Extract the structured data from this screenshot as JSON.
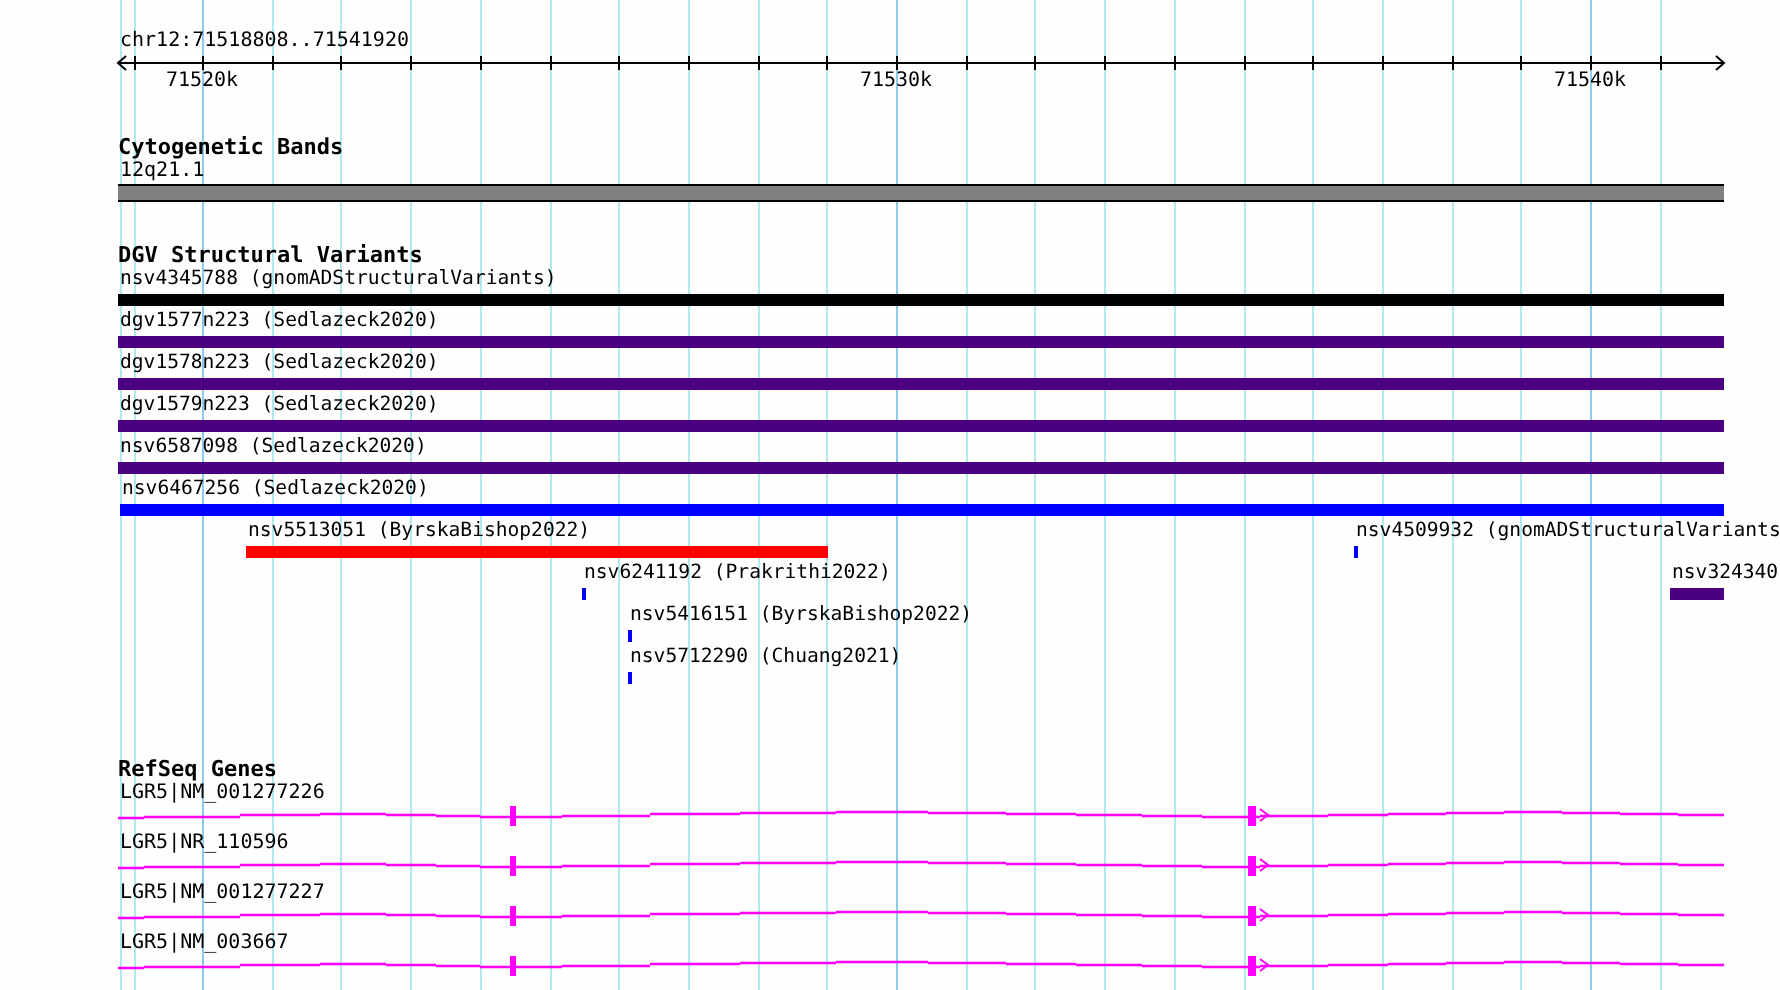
{
  "location": "chr12:71518808..71541920",
  "ruler": {
    "ticks": [
      "71520k",
      "71530k",
      "71540k"
    ]
  },
  "tracks": [
    {
      "title": "Cytogenetic Bands",
      "kind": "bands",
      "features": [
        {
          "label": "12q21.1",
          "color": "#808080"
        }
      ]
    },
    {
      "title": "DGV Structural Variants",
      "kind": "variants",
      "features": [
        {
          "label": "nsv4345788 (gnomADStructuralVariants)",
          "color": "#000000"
        },
        {
          "label": "dgv1577n223 (Sedlazeck2020)",
          "color": "#4b0082"
        },
        {
          "label": "dgv1578n223 (Sedlazeck2020)",
          "color": "#4b0082"
        },
        {
          "label": "dgv1579n223 (Sedlazeck2020)",
          "color": "#4b0082"
        },
        {
          "label": "nsv6587098 (Sedlazeck2020)",
          "color": "#4b0082"
        },
        {
          "label": "nsv6467256 (Sedlazeck2020)",
          "color": "#0000ff"
        },
        {
          "label": "nsv5513051 (ByrskaBishop2022)",
          "color": "#ff0000"
        },
        {
          "label": "nsv4509932 (gnomADStructuralVariants",
          "color": "#0000ff"
        },
        {
          "label": "nsv6241192 (Prakrithi2022)",
          "color": "#0000ff"
        },
        {
          "label": "nsv324340",
          "color": "#4b0082"
        },
        {
          "label": "nsv5416151 (ByrskaBishop2022)",
          "color": "#0000ff"
        },
        {
          "label": "nsv5712290 (Chuang2021)",
          "color": "#0000ff"
        }
      ]
    },
    {
      "title": "RefSeq Genes",
      "kind": "genes",
      "features": [
        {
          "label": "LGR5|NM_001277226",
          "color": "#ff00ff"
        },
        {
          "label": "LGR5|NR_110596",
          "color": "#ff00ff"
        },
        {
          "label": "LGR5|NM_001277227",
          "color": "#ff00ff"
        },
        {
          "label": "LGR5|NM_003667",
          "color": "#ff00ff"
        }
      ]
    }
  ]
}
